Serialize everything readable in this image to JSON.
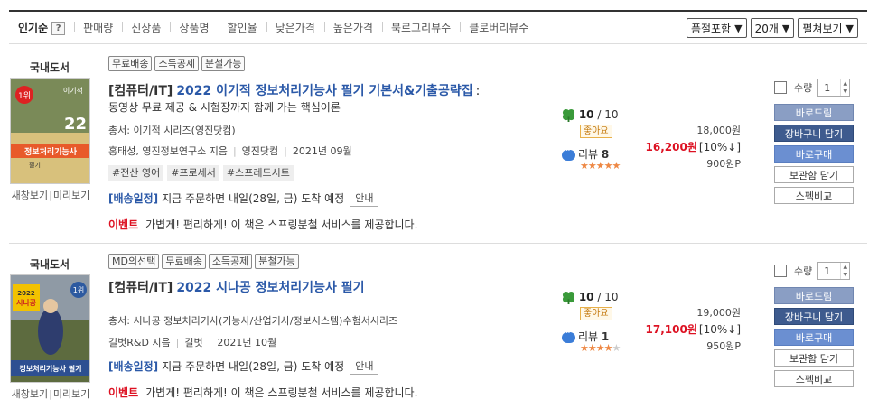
{
  "sortbar": {
    "items": [
      "인기순",
      "판매량",
      "신상품",
      "상품명",
      "할인율",
      "낮은가격",
      "높은가격",
      "북로그리뷰수",
      "클로버리뷰수"
    ],
    "help": "?",
    "selects": [
      "품절포함",
      "20개",
      "펼쳐보기"
    ]
  },
  "products": [
    {
      "category": "국내도서",
      "cover_links": [
        "새창보기",
        "미리보기"
      ],
      "tags": [
        "무료배송",
        "소득공제",
        "분철가능"
      ],
      "genre": "[컴퓨터/IT]",
      "title": "2022 이기적 정보처리기능사 필기 기본서&기출공략집",
      "title_suffix": ":",
      "subtitle": "동영상 무료 제공 & 시험장까지 함께 가는 핵심이론",
      "series": "총서: 이기적 시리즈(영진닷컴)",
      "author": "홍태성, 영진정보연구소 지음",
      "publisher": "영진닷컴",
      "date": "2021년 09월",
      "keywords": [
        "#전산 영어",
        "#프로세서",
        "#스프레드시트"
      ],
      "delivery_label": "[배송일정]",
      "delivery_text": "지금 주문하면 내일(28일, 금) 도착 예정",
      "delivery_btn": "안내",
      "event_label": "이벤트",
      "event_text": "가볍게! 편리하게! 이 책은 스프링분철 서비스를 제공합니다.",
      "score": "10",
      "score_max": "/ 10",
      "good_label": "좋아요",
      "review_label": "리뷰",
      "review_count": "8",
      "stars": 5,
      "list_price": "18,000원",
      "sale_price": "16,200원",
      "discount": "[10%↓]",
      "points": "900원P",
      "qty_label": "수량",
      "qty_value": "1",
      "buttons": [
        "바로드림",
        "장바구니 담기",
        "바로구매",
        "보관함 담기",
        "스펙비교"
      ],
      "cover_text": {
        "badge": "1위",
        "big": "22",
        "brand": "이기적",
        "title": "정보처리기능사",
        "sub": "필기"
      }
    },
    {
      "category": "국내도서",
      "cover_links": [
        "새창보기",
        "미리보기"
      ],
      "tags": [
        "MD의선택",
        "무료배송",
        "소득공제",
        "분철가능"
      ],
      "genre": "[컴퓨터/IT]",
      "title": "2022 시나공 정보처리기능사 필기",
      "title_suffix": "",
      "subtitle": "",
      "series": "총서: 시나공 정보처리기사(기능사/산업기사/정보시스템)수험서시리즈",
      "author": "길벗R&D 지음",
      "publisher": "길벗",
      "date": "2021년 10월",
      "keywords": [],
      "delivery_label": "[배송일정]",
      "delivery_text": "지금 주문하면 내일(28일, 금) 도착 예정",
      "delivery_btn": "안내",
      "event_label": "이벤트",
      "event_text": "가볍게! 편리하게! 이 책은 스프링분철 서비스를 제공합니다.",
      "score": "10",
      "score_max": "/ 10",
      "good_label": "좋아요",
      "review_label": "리뷰",
      "review_count": "1",
      "stars": 4,
      "list_price": "19,000원",
      "sale_price": "17,100원",
      "discount": "[10%↓]",
      "points": "950원P",
      "qty_label": "수량",
      "qty_value": "1",
      "buttons": [
        "바로드림",
        "장바구니 담기",
        "바로구매",
        "보관함 담기",
        "스펙비교"
      ],
      "cover_text": {
        "badge": "1위",
        "big": "2022",
        "brand": "시나공",
        "title": "정보처리기능사 필기",
        "sub": ""
      }
    }
  ]
}
